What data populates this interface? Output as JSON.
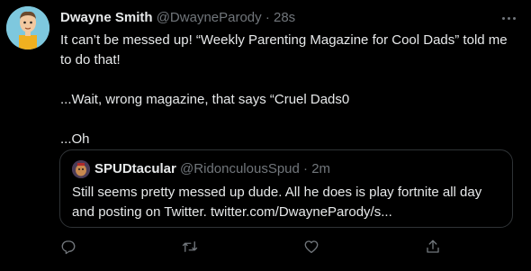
{
  "tweet": {
    "author": {
      "display_name": "Dwayne Smith",
      "handle": "@DwayneParody",
      "separator": "·",
      "time": "28s"
    },
    "body": {
      "line1": "It can’t be messed up! “Weekly Parenting Magazine for Cool Dads” told me to do that!",
      "line2": "...Wait, wrong magazine, that says “Cruel Dads0",
      "line3": "...Oh"
    },
    "quoted": {
      "display_name": "SPUDtacular",
      "handle": "@RidonculousSpud",
      "separator": "·",
      "time": "2m",
      "text": "Still seems pretty messed up dude. All he does is play fortnite all day and posting on Twitter. twitter.com/DwayneParody/s..."
    },
    "actions": {
      "reply_icon": "reply-icon",
      "retweet_icon": "retweet-icon",
      "like_icon": "like-icon",
      "share_icon": "share-icon"
    },
    "colors": {
      "background": "#000000",
      "text": "#e7e9ea",
      "secondary": "#71767b",
      "border": "#2f3336"
    }
  }
}
